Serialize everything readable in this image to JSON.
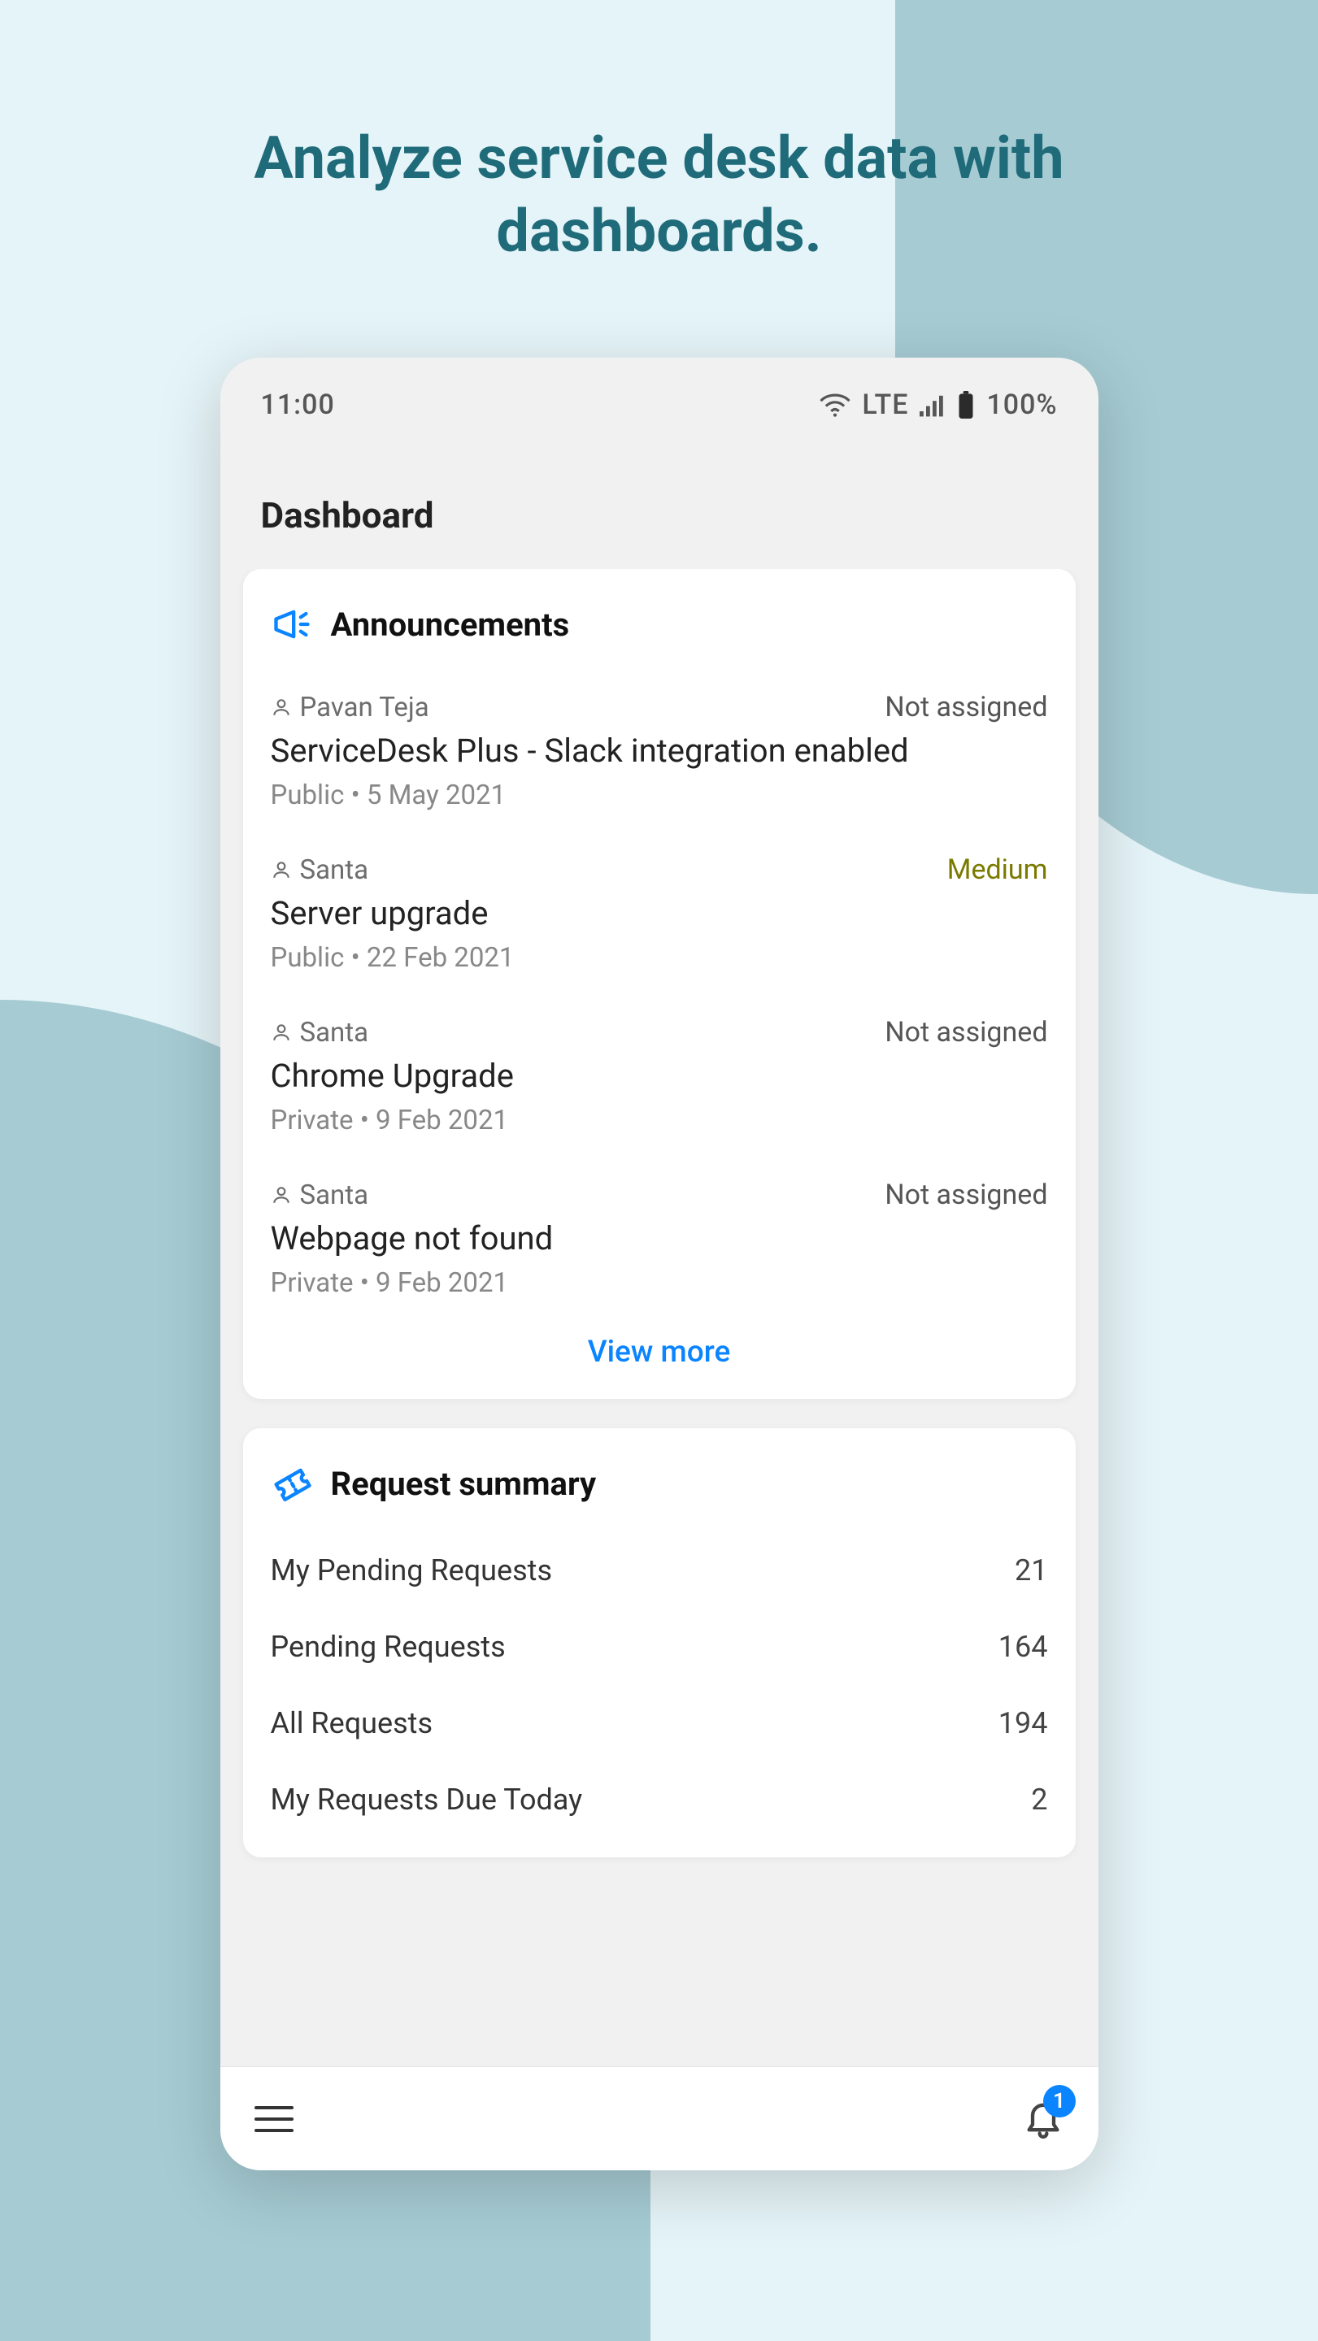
{
  "headline": "Analyze service desk data with dashboards.",
  "status_bar": {
    "time": "11:00",
    "network": "LTE",
    "battery": "100%"
  },
  "page_title": "Dashboard",
  "announcements": {
    "title": "Announcements",
    "view_more": "View more",
    "items": [
      {
        "user": "Pavan Teja",
        "status": "Not assigned",
        "status_class": "",
        "title": "ServiceDesk Plus - Slack integration enabled",
        "visibility": "Public",
        "date": "5 May 2021"
      },
      {
        "user": "Santa",
        "status": "Medium",
        "status_class": "medium",
        "title": "Server upgrade",
        "visibility": "Public",
        "date": "22 Feb 2021"
      },
      {
        "user": "Santa",
        "status": "Not assigned",
        "status_class": "",
        "title": "Chrome Upgrade",
        "visibility": "Private",
        "date": "9 Feb 2021"
      },
      {
        "user": "Santa",
        "status": "Not assigned",
        "status_class": "",
        "title": "Webpage not found",
        "visibility": "Private",
        "date": "9 Feb 2021"
      }
    ]
  },
  "request_summary": {
    "title": "Request summary",
    "items": [
      {
        "label": "My Pending Requests",
        "count": "21"
      },
      {
        "label": "Pending Requests",
        "count": "164"
      },
      {
        "label": "All Requests",
        "count": "194"
      },
      {
        "label": "My Requests Due Today",
        "count": "2"
      }
    ]
  },
  "notifications_badge": "1"
}
